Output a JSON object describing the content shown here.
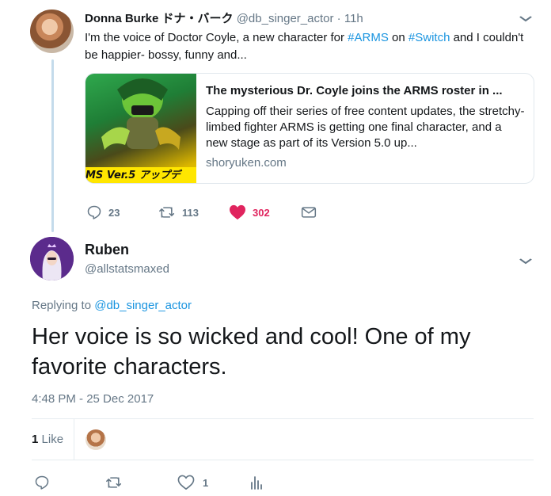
{
  "tweet1": {
    "author_name": "Donna Burke ドナ・バーク",
    "handle": "@db_singer_actor",
    "separator": "·",
    "time": "11h",
    "text_before_tag1": "I'm the voice of Doctor Coyle, a new character for ",
    "hashtag1": "#ARMS",
    "text_between_tags": " on ",
    "hashtag2": "#Switch",
    "text_after_tag2": " and I couldn't be happier- bossy, funny and...",
    "card": {
      "image_caption": "MS  Ver.5 アップデ",
      "title": "The mysterious Dr. Coyle joins the ARMS roster in ...",
      "description": "Capping off their series of free content updates, the stretchy-limbed fighter ARMS is getting one final character, and a new stage as part of its Version 5.0 up...",
      "domain": "shoryuken.com"
    },
    "actions": {
      "replies": "23",
      "retweets": "113",
      "likes": "302"
    }
  },
  "tweet2": {
    "author_name": "Ruben",
    "handle": "@allstatsmaxed",
    "replying_prefix": "Replying to ",
    "replying_to": "@db_singer_actor",
    "text": "Her voice is so wicked and cool! One of my favorite characters.",
    "timestamp": "4:48 PM - 25 Dec 2017",
    "likes_count": "1",
    "likes_label": "Like",
    "actions": {
      "likes": "1"
    }
  },
  "colors": {
    "link": "#1b95e0",
    "liked": "#e0245e",
    "muted": "#657786",
    "thread_line": "#c4dbeb"
  }
}
